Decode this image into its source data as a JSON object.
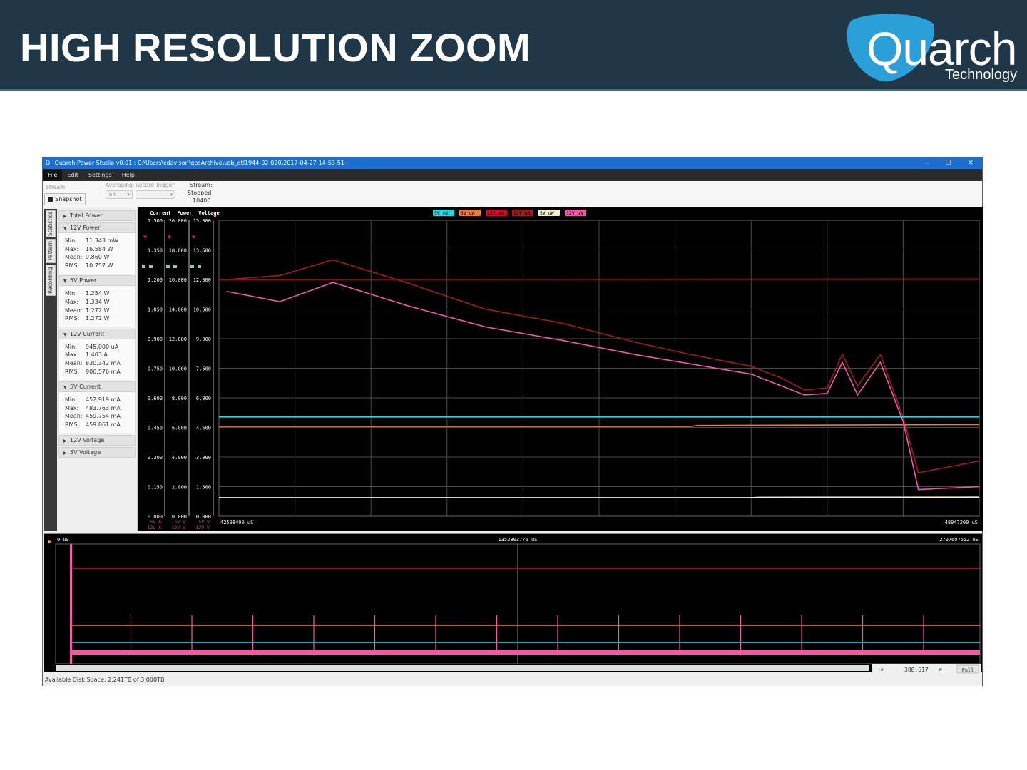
{
  "slide": {
    "title": "HIGH RESOLUTION ZOOM",
    "logo_text": "Quarch",
    "logo_sub": "Technology",
    "colors": {
      "header_bg": "#1f3747",
      "logo_blue": "#2a9fd8"
    }
  },
  "window": {
    "title": "Quarch Power Studio v0.01 : C:\\Users\\cdavison\\qpsArchive\\usb_qtl1944-02-020\\2017-04-27-14-53-51",
    "icon": "app-q-icon",
    "buttons": {
      "minimize": "—",
      "restore": "❐",
      "close": "✕"
    }
  },
  "menu": [
    "File",
    "Edit",
    "Settings",
    "Help"
  ],
  "toolbar": {
    "stream_label": "Stream",
    "snapshot_label": "Snapshot",
    "averaging_label": "Averaging:",
    "averaging_value": "64",
    "record_trigger_label": "Record Trigger:",
    "stream_status_label": "Stream:",
    "stream_status": "Stopped",
    "stream_count": "10400"
  },
  "side_tabs": [
    "Statistics",
    "Pattern",
    "Recording"
  ],
  "stats": {
    "sections": [
      {
        "title": "Total Power",
        "expanded": false
      },
      {
        "title": "12V Power",
        "expanded": true,
        "rows": [
          [
            "Min:",
            "11.343 mW"
          ],
          [
            "Max:",
            "16.584 W"
          ],
          [
            "Mean:",
            "9.860 W"
          ],
          [
            "RMS:",
            "10.757 W"
          ]
        ]
      },
      {
        "title": "5V Power",
        "expanded": true,
        "rows": [
          [
            "Min:",
            "1.254 W"
          ],
          [
            "Max:",
            "1.334 W"
          ],
          [
            "Mean:",
            "1.272 W"
          ],
          [
            "RMS:",
            "1.272 W"
          ]
        ]
      },
      {
        "title": "12V Current",
        "expanded": true,
        "rows": [
          [
            "Min:",
            "945.000 uA"
          ],
          [
            "Max:",
            "1.403 A"
          ],
          [
            "Mean:",
            "830.342 mA"
          ],
          [
            "RMS:",
            "906.576 mA"
          ]
        ]
      },
      {
        "title": "5V Current",
        "expanded": true,
        "rows": [
          [
            "Min:",
            "452.919 mA"
          ],
          [
            "Max:",
            "483.763 mA"
          ],
          [
            "Mean:",
            "459.754 mA"
          ],
          [
            "RMS:",
            "459.861 mA"
          ]
        ]
      },
      {
        "title": "12V Voltage",
        "expanded": false
      },
      {
        "title": "5V Voltage",
        "expanded": false
      }
    ]
  },
  "chart_data": [
    {
      "type": "line",
      "axes": [
        {
          "name": "Current",
          "ticks": [
            "1.500",
            "1.350",
            "1.200",
            "1.050",
            "0.900",
            "0.750",
            "0.600",
            "0.450",
            "0.300",
            "0.150",
            "0.000"
          ],
          "units": [
            "5V A",
            "12V A"
          ]
        },
        {
          "name": "Power",
          "ticks": [
            "20.000",
            "18.000",
            "16.000",
            "14.000",
            "12.000",
            "10.000",
            "8.000",
            "6.000",
            "4.000",
            "2.000",
            "0.000"
          ],
          "units": [
            "5V W",
            "12V W"
          ]
        },
        {
          "name": "Voltage",
          "ticks": [
            "15.000",
            "13.500",
            "12.000",
            "10.500",
            "9.000",
            "7.500",
            "6.000",
            "4.500",
            "3.000",
            "1.500",
            "0.000"
          ],
          "units": [
            "5V V",
            "12V V"
          ]
        }
      ],
      "x_start": "42598400 uS",
      "x_end": "48947200 uS",
      "legend": [
        {
          "label": "5V mV",
          "color": "#2fd3e0"
        },
        {
          "label": "5V uA",
          "color": "#f07a3a"
        },
        {
          "label": "12V mV",
          "color": "#c8102e"
        },
        {
          "label": "12V uA",
          "color": "#a31b1b"
        },
        {
          "label": "5V uW",
          "color": "#f5f0d0"
        },
        {
          "label": "12V uW",
          "color": "#f05aa8"
        }
      ],
      "grid": true,
      "series": [
        {
          "name": "12V mV",
          "color": "#c8102e",
          "x": [
            0,
            1
          ],
          "y": [
            12.0,
            12.02
          ]
        },
        {
          "name": "12V uA",
          "color": "#a31b1b",
          "x": [
            0.01,
            0.08,
            0.15,
            0.25,
            0.35,
            0.45,
            0.55,
            0.62,
            0.7,
            0.74,
            0.76,
            0.77,
            0.8,
            0.82,
            0.84,
            0.87,
            0.9,
            0.92,
            1.0
          ],
          "y": [
            1.2,
            1.22,
            1.3,
            1.18,
            1.05,
            0.98,
            0.88,
            0.82,
            0.76,
            0.7,
            0.66,
            0.64,
            0.65,
            0.82,
            0.66,
            0.82,
            0.5,
            0.22,
            0.28
          ]
        },
        {
          "name": "12V uW",
          "color": "#f05aa8",
          "x": [
            0.01,
            0.08,
            0.15,
            0.25,
            0.35,
            0.45,
            0.55,
            0.62,
            0.7,
            0.74,
            0.76,
            0.77,
            0.8,
            0.82,
            0.84,
            0.87,
            0.9,
            0.92,
            1.0
          ],
          "y": [
            15.2,
            14.5,
            15.8,
            14.2,
            12.8,
            11.9,
            10.9,
            10.3,
            9.6,
            8.8,
            8.4,
            8.2,
            8.3,
            10.4,
            8.2,
            10.4,
            6.4,
            1.8,
            2.0
          ]
        },
        {
          "name": "5V uA",
          "color": "#f07a3a",
          "x": [
            0,
            0.62,
            0.63,
            1.0
          ],
          "y": [
            0.455,
            0.455,
            0.46,
            0.465
          ]
        },
        {
          "name": "5V mV",
          "color": "#2fd3e0",
          "x": [
            0,
            1
          ],
          "y": [
            5.03,
            5.03
          ]
        },
        {
          "name": "5V uW",
          "color": "#f5f0d0",
          "x": [
            0,
            0.7,
            0.71,
            1.0
          ],
          "y": [
            1.26,
            1.26,
            1.28,
            1.29
          ]
        }
      ]
    },
    {
      "type": "line",
      "title": "overview",
      "x_start": "0 uS",
      "x_mid": "1353803776 uS",
      "x_end": "2707607552 uS",
      "grid": false
    }
  ],
  "zoom": {
    "value": "388.617",
    "full_label": "Full"
  },
  "status": {
    "disk": "Available Disk Space: 2.241TB of 3.000TB"
  }
}
